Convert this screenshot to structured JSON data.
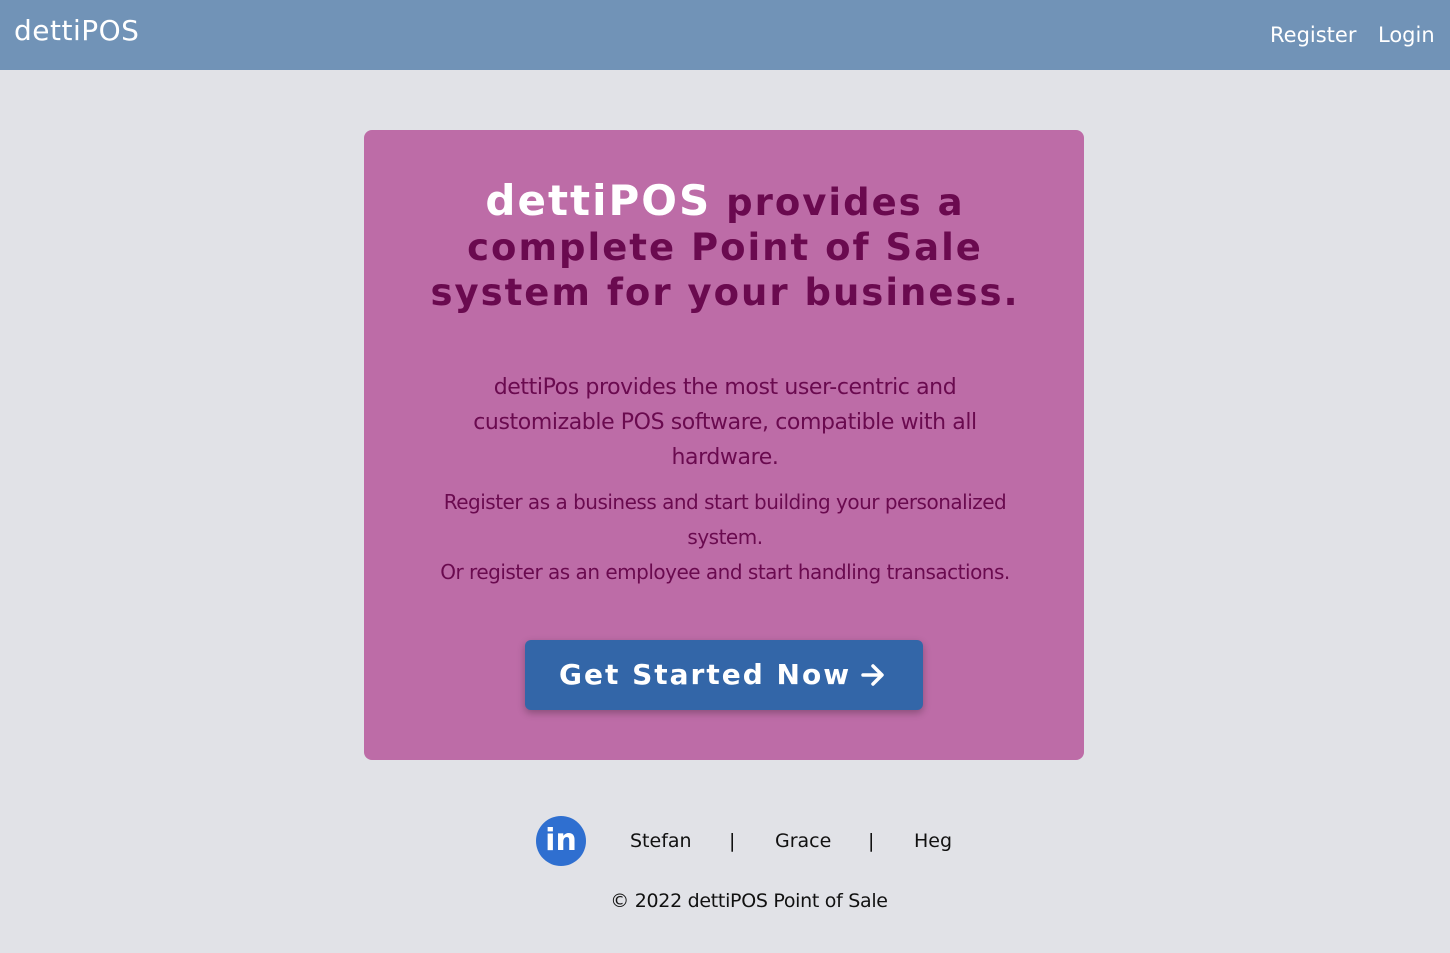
{
  "navbar": {
    "brand": "dettiPOS",
    "register_label": "Register",
    "login_label": "Login"
  },
  "hero": {
    "headline_brand": "dettiPOS",
    "headline_rest": " provides a complete Point of Sale system for your business.",
    "description": "dettiPos provides the most user-centric and customizable POS software, compatible with all hardware.",
    "business_line": "Register as a business and start building your personalized system.",
    "employee_line": "Or register as an employee and start handling transactions.",
    "cta_label": "Get Started Now",
    "cta_icon": "arrow-right-icon"
  },
  "footer": {
    "social_icon": "linkedin-icon",
    "social_label": "in",
    "links": [
      "Stefan",
      "Grace",
      "Heg"
    ],
    "separator": "|",
    "copyright": "© 2022 dettiPOS Point of Sale"
  },
  "colors": {
    "navbar_bg": "#7193b7",
    "page_bg": "#e1e2e7",
    "hero_bg": "#bd6ca7",
    "hero_text": "#6a0a4f",
    "cta_bg": "#3366a8",
    "linkedin_bg": "#2f6fd0"
  }
}
